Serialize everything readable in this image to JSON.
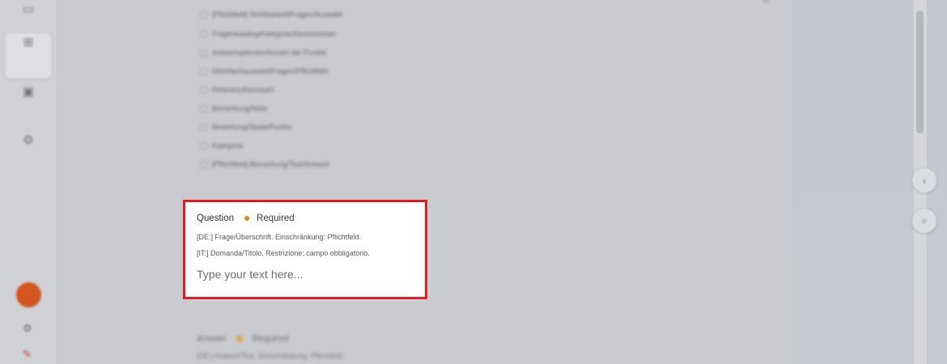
{
  "rail": {
    "items": [
      {
        "icon": "▭",
        "label": ""
      },
      {
        "icon": "⊞",
        "label": ""
      },
      {
        "icon": "▣",
        "label": ""
      },
      {
        "icon": "⚙",
        "label": ""
      }
    ],
    "bottom_icons": [
      "⚙",
      "✎"
    ]
  },
  "options": [
    "[Pflichtfeld] Sichtbarkeit/Fragen/Auswahl",
    "Fragenkatalog/Kategorie/Kennzeichen",
    "Antwortoptionen/Anzahl der Punkte",
    "Mehrfachauswahl/Fragen/Pflichtfeld",
    "Referenz/Kennzahl",
    "Bemerkung/Notiz",
    "Bewertung/Skala/Punkte",
    "Kategorie",
    "[Pflichtfeld] Bemerkung/Text/Antwort"
  ],
  "question_card": {
    "title": "Question",
    "required": "Required",
    "hint_de": "[DE:] Frage/Überschrift. Einschränkung: Pflichtfeld.",
    "hint_it": "[IT:] Domanda/Titolo. Restrizione: campo obbligatorio.",
    "placeholder": "Type your text here..."
  },
  "next_question": {
    "title": "Answer",
    "required": "Required",
    "hint": "[DE:] Antwort/Text. Einschränkung: Pflichtfeld."
  },
  "colors": {
    "highlight": "#e01b24",
    "required_dot": "#d08a1d",
    "avatar": "#d4561f"
  }
}
